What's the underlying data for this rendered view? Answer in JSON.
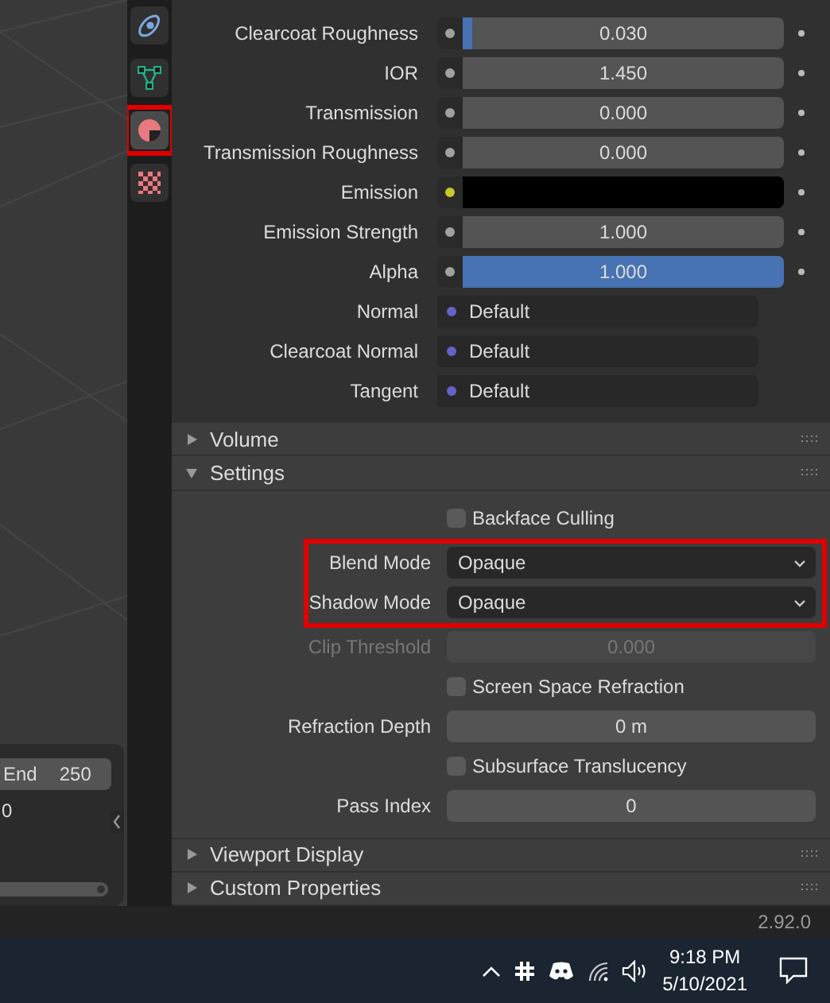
{
  "timeline": {
    "end_label": "End",
    "end_value": "250",
    "current_frame": "0"
  },
  "tabs": [
    {
      "kind": "physics",
      "selected": false,
      "highlighted": false
    },
    {
      "kind": "data",
      "selected": false,
      "highlighted": false
    },
    {
      "kind": "material",
      "selected": true,
      "highlighted": true
    },
    {
      "kind": "texture",
      "selected": false,
      "highlighted": false
    }
  ],
  "inputs": [
    {
      "label": "Clearcoat Roughness",
      "kind": "slider",
      "value": "0.030",
      "level": 0.03
    },
    {
      "label": "IOR",
      "kind": "number",
      "value": "1.450"
    },
    {
      "label": "Transmission",
      "kind": "number",
      "value": "0.000"
    },
    {
      "label": "Transmission Roughness",
      "kind": "number",
      "value": "0.000"
    },
    {
      "label": "Emission",
      "kind": "color",
      "color": "#000000"
    },
    {
      "label": "Emission Strength",
      "kind": "number",
      "value": "1.000"
    },
    {
      "label": "Alpha",
      "kind": "slider",
      "value": "1.000",
      "level": 1.0
    },
    {
      "label": "Normal",
      "kind": "vector",
      "value": "Default"
    },
    {
      "label": "Clearcoat Normal",
      "kind": "vector",
      "value": "Default"
    },
    {
      "label": "Tangent",
      "kind": "vector",
      "value": "Default"
    }
  ],
  "panels": [
    {
      "title": "Volume",
      "expanded": false
    },
    {
      "title": "Settings",
      "expanded": true,
      "rows": [
        {
          "kind": "checkbox",
          "label": "Backface Culling",
          "checked": false,
          "highlighted": false
        },
        {
          "kind": "dropdown",
          "label": "Blend Mode",
          "value": "Opaque",
          "highlighted": true
        },
        {
          "kind": "dropdown",
          "label": "Shadow Mode",
          "value": "Opaque",
          "highlighted": true
        },
        {
          "kind": "number",
          "label": "Clip Threshold",
          "value": "0.000",
          "disabled": true,
          "highlighted": false
        },
        {
          "kind": "checkbox",
          "label": "Screen Space Refraction",
          "checked": false,
          "highlighted": false
        },
        {
          "kind": "number",
          "label": "Refraction Depth",
          "value": "0 m",
          "disabled": false,
          "highlighted": false
        },
        {
          "kind": "checkbox",
          "label": "Subsurface Translucency",
          "checked": false,
          "highlighted": false
        },
        {
          "kind": "number",
          "label": "Pass Index",
          "value": "0",
          "disabled": false,
          "highlighted": false
        }
      ]
    },
    {
      "title": "Viewport Display",
      "expanded": false
    },
    {
      "title": "Custom Properties",
      "expanded": false
    }
  ],
  "status_bar": {
    "version": "2.92.0"
  },
  "taskbar": {
    "time": "9:18 PM",
    "date": "5/10/2021"
  }
}
